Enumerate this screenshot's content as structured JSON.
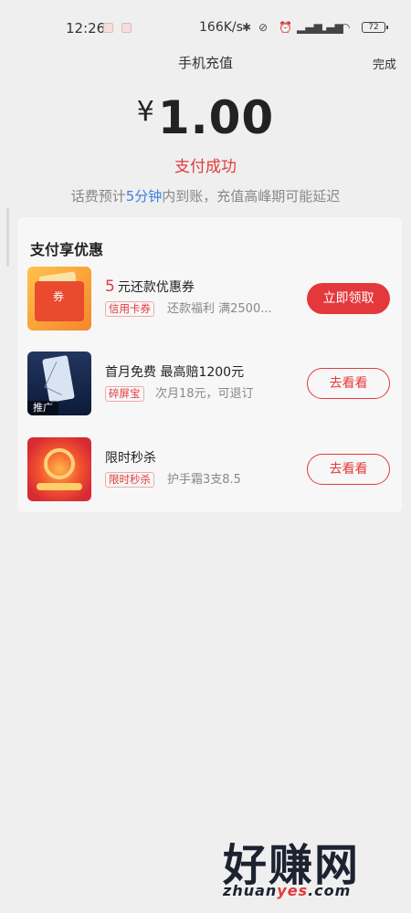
{
  "status_bar": {
    "time": "12:26",
    "net_speed": "166K/s",
    "battery": "72",
    "icons": [
      "bluetooth-icon",
      "mute-icon",
      "alarm-icon",
      "hd-signal-icon",
      "hd-signal-icon",
      "wifi-icon",
      "battery-icon"
    ]
  },
  "header": {
    "title": "手机充值",
    "done_label": "完成"
  },
  "payment": {
    "currency": "¥",
    "amount": "1.00",
    "status": "支付成功",
    "notice_prefix": "话费预计",
    "notice_highlight": "5分钟",
    "notice_suffix": "内到账，充值高峰期可能延迟"
  },
  "offers": {
    "title": "支付享优惠",
    "items": [
      {
        "title_num": "5",
        "title_text": "元还款优惠券",
        "tag": "信用卡券",
        "desc": "还款福利 满2500...",
        "button": "立即领取",
        "thumb_icon": "coupon-envelope-icon"
      },
      {
        "title_num": "",
        "title_text": "首月免费 最高赔1200元",
        "tag": "碎屏宝",
        "desc": "次月18元，可退订",
        "button": "去看看",
        "thumb_label": "推广",
        "thumb_icon": "cracked-phone-icon"
      },
      {
        "title_num": "",
        "title_text": "限时秒杀",
        "tag": "限时秒杀",
        "desc": "护手霜3支8.5",
        "button": "去看看",
        "thumb_icon": "flash-sale-icon"
      }
    ]
  },
  "watermark": {
    "text_cn": "好赚网",
    "url_pre": "zhuan",
    "url_red": "yes",
    "url_post": ".com"
  },
  "colors": {
    "accent": "#e4393c",
    "highlight": "#3b7ee0",
    "background": "#efefef"
  }
}
